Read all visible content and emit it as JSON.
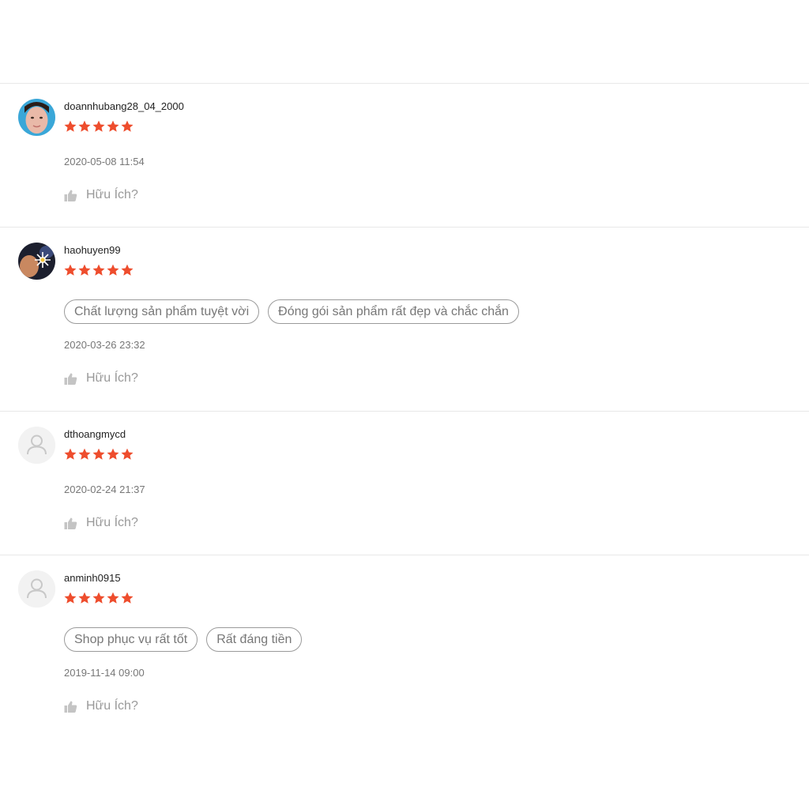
{
  "colors": {
    "star": "#ee4d2d",
    "divider": "#e8e8e8",
    "muted_text": "#777777"
  },
  "reviews": [
    {
      "username": "doannhubang28_04_2000",
      "rating": 5,
      "avatar": "photo",
      "tags": [],
      "date": "2020-05-08 11:54",
      "helpful_label": "Hữu Ích?"
    },
    {
      "username": "haohuyen99",
      "rating": 5,
      "avatar": "photo",
      "tags": [
        "Chất lượng sản phẩm tuyệt vời",
        "Đóng gói sản phẩm rất đẹp và chắc chắn"
      ],
      "date": "2020-03-26 23:32",
      "helpful_label": "Hữu Ích?"
    },
    {
      "username": "dthoangmycd",
      "rating": 5,
      "avatar": "default-user-icon",
      "tags": [],
      "date": "2020-02-24 21:37",
      "helpful_label": "Hữu Ích?"
    },
    {
      "username": "anminh0915",
      "rating": 5,
      "avatar": "default-user-icon",
      "tags": [
        "Shop phục vụ rất tốt",
        "Rất đáng tiền"
      ],
      "date": "2019-11-14 09:00",
      "helpful_label": "Hữu Ích?"
    }
  ]
}
